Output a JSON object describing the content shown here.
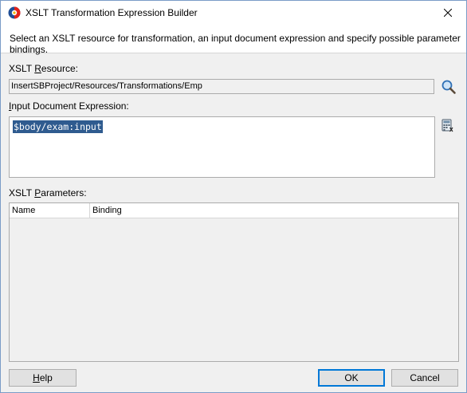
{
  "window": {
    "title": "XSLT Transformation Expression Builder",
    "description": "Select an XSLT resource for transformation, an input document expression and specify possible parameter bindings."
  },
  "xslt_resource": {
    "label_prefix": "XSLT ",
    "label_mnemonic": "R",
    "label_suffix": "esource:",
    "value": "InsertSBProject/Resources/Transformations/Emp"
  },
  "input_expression": {
    "label_mnemonic": "I",
    "label_suffix": "nput Document Expression:",
    "value": "$body/exam:input"
  },
  "xslt_parameters": {
    "label_prefix": "XSLT ",
    "label_mnemonic": "P",
    "label_suffix": "arameters:",
    "columns": [
      "Name",
      "Binding"
    ],
    "rows": []
  },
  "buttons": {
    "help_mnemonic": "H",
    "help_rest": "elp",
    "ok": "OK",
    "cancel": "Cancel"
  },
  "icons": {
    "app": "oracle-jdeveloper-icon",
    "close": "close-icon",
    "search": "search-icon",
    "expression_builder": "calculator-icon"
  },
  "colors": {
    "selection": "#2f5b8f",
    "window_border": "#7a9cc7",
    "default_button_border": "#0078d7"
  }
}
